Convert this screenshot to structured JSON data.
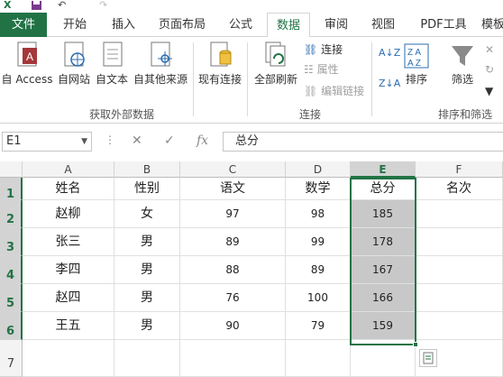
{
  "quick_access": {
    "excel_icon": "excel-icon",
    "save_icon": "save-icon",
    "undo_icon": "undo-icon",
    "redo_icon": "redo-icon"
  },
  "tabs": [
    {
      "label": "文件"
    },
    {
      "label": "开始"
    },
    {
      "label": "插入"
    },
    {
      "label": "页面布局"
    },
    {
      "label": "公式"
    },
    {
      "label": "数据"
    },
    {
      "label": "审阅"
    },
    {
      "label": "视图"
    },
    {
      "label": "PDF工具"
    },
    {
      "label": "模板"
    }
  ],
  "active_tab": "数据",
  "ribbon": {
    "get_external": {
      "from_access": "自 Access",
      "from_web": "自网站",
      "from_text": "自文本",
      "from_other": "自其他来源",
      "existing": "现有连接",
      "group_label": "获取外部数据"
    },
    "connections": {
      "refresh_all": "全部刷新",
      "connections": "连接",
      "properties": "属性",
      "edit_links": "编辑链接",
      "group_label": "连接"
    },
    "sort_filter": {
      "sort": "排序",
      "filter": "筛选",
      "group_label": "排序和筛选"
    }
  },
  "formula_bar": {
    "name_box": "E1",
    "formula": "总分"
  },
  "colors": {
    "accent": "#217346",
    "highlight": "#c8c8c8"
  },
  "sheet": {
    "columns": [
      "A",
      "B",
      "C",
      "D",
      "E",
      "F"
    ],
    "rows": [
      "1",
      "2",
      "3",
      "4",
      "5",
      "6",
      "7"
    ],
    "selected_column": "E",
    "cells": [
      [
        "姓名",
        "性别",
        "语文",
        "数学",
        "总分",
        "名次"
      ],
      [
        "赵柳",
        "女",
        "97",
        "98",
        "185",
        ""
      ],
      [
        "张三",
        "男",
        "89",
        "99",
        "178",
        ""
      ],
      [
        "李四",
        "男",
        "88",
        "89",
        "167",
        ""
      ],
      [
        "赵四",
        "男",
        "76",
        "100",
        "166",
        ""
      ],
      [
        "王五",
        "男",
        "90",
        "79",
        "159",
        ""
      ],
      [
        "",
        "",
        "",
        "",
        "",
        ""
      ]
    ]
  }
}
